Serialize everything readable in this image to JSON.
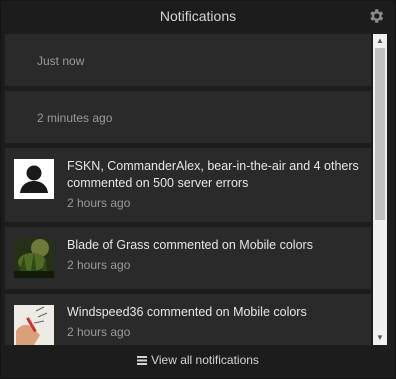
{
  "header": {
    "title": "Notifications",
    "settings_icon": "gear-icon"
  },
  "notifications": [
    {
      "message": "",
      "time": "Just now"
    },
    {
      "message": "",
      "time": "2 minutes ago"
    },
    {
      "message": "FSKN, CommanderAlex, bear-in-the-air and 4 others commented on 500 server errors",
      "time": "2 hours ago",
      "avatar": "default-user-avatar"
    },
    {
      "message": "Blade of Grass commented on Mobile colors",
      "time": "2 hours ago",
      "avatar": "blade-of-grass-avatar"
    },
    {
      "message": "Windspeed36 commented on Mobile colors",
      "time": "2 hours ago",
      "avatar": "windspeed36-avatar"
    }
  ],
  "footer": {
    "label": "View all notifications",
    "icon": "menu-icon"
  }
}
